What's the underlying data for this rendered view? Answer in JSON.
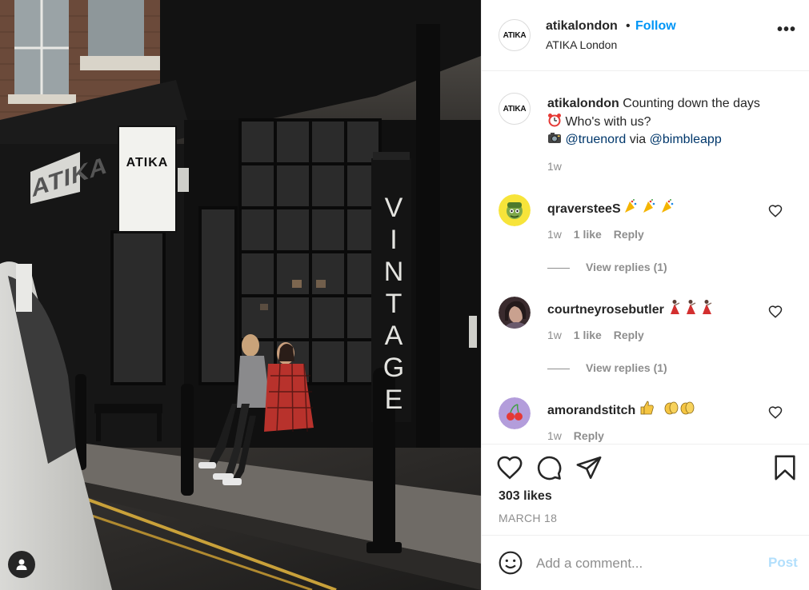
{
  "post": {
    "username": "atikalondon",
    "separator": "•",
    "follow_label": "Follow",
    "location": "ATIKA London",
    "avatar_text": "ATIKA",
    "more_label": "•••"
  },
  "photo": {
    "shop_sign": "ATIKA",
    "banner_letters": [
      "V",
      "I",
      "N",
      "T",
      "A",
      "G",
      "E"
    ],
    "storefront_text": "ATIKA"
  },
  "caption": {
    "username": "atikalondon",
    "text_1": " Counting down the days",
    "text_2": " Who's with us?",
    "mention_1": "@truenord",
    "via": " via ",
    "mention_2": "@bimbleapp",
    "time": "1w"
  },
  "comments": [
    {
      "username": "qraversteeS",
      "emojis": "party-poppers",
      "time": "1w",
      "likes": "1 like",
      "reply": "Reply",
      "view_replies": "View replies (1)"
    },
    {
      "username": "courtneyrosebutler",
      "emojis": "dancers",
      "time": "1w",
      "likes": "1 like",
      "reply": "Reply",
      "view_replies": "View replies (1)"
    },
    {
      "username": "amorandstitch",
      "emojis": "thumbs-and-clap",
      "time": "1w",
      "reply": "Reply"
    }
  ],
  "stats": {
    "likes": "303 likes",
    "date": "MARCH 18"
  },
  "add_comment": {
    "placeholder": "Add a comment...",
    "post_label": "Post"
  },
  "colors": {
    "accent": "#0095f6",
    "mention": "#00376b",
    "muted": "#8e8e8e",
    "post_disabled": "#b2dffc"
  }
}
